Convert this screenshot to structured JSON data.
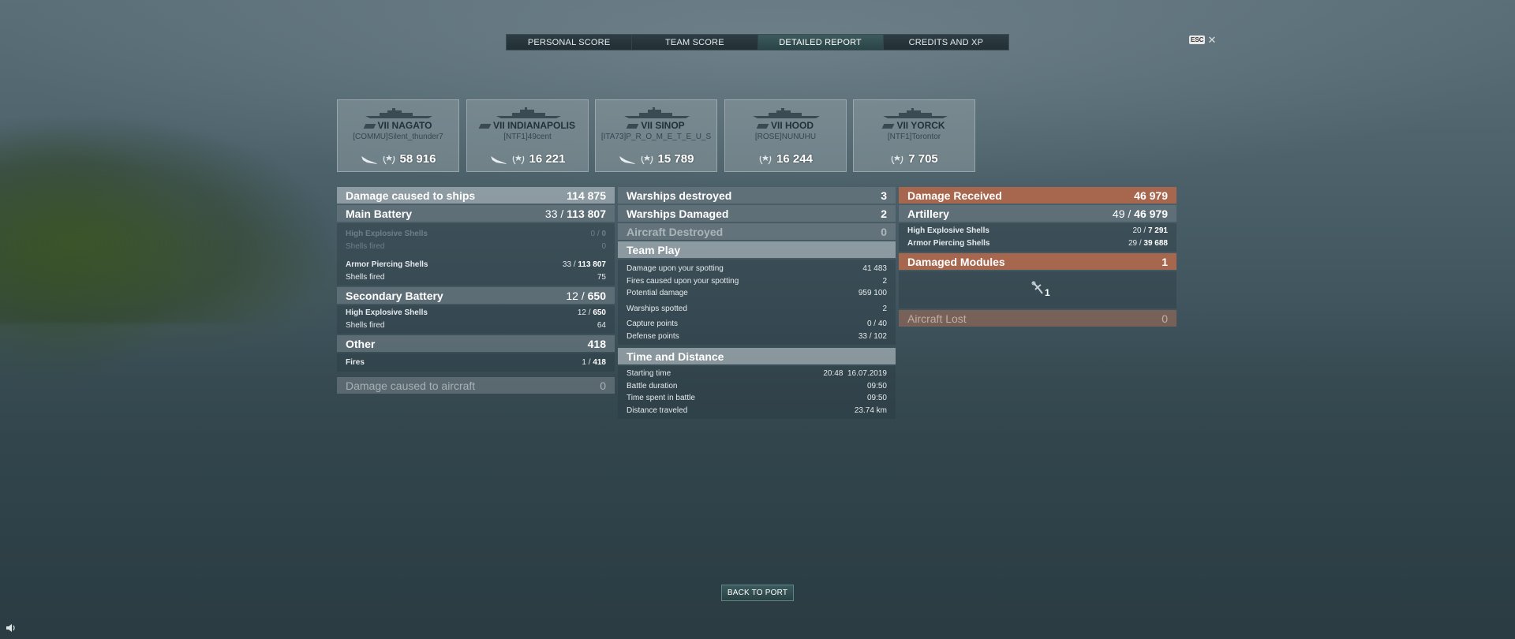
{
  "tabs": [
    {
      "label": "PERSONAL SCORE"
    },
    {
      "label": "TEAM SCORE"
    },
    {
      "label": "DETAILED REPORT"
    },
    {
      "label": "CREDITS AND XP"
    }
  ],
  "esc": {
    "key": "ESC",
    "close": "✕"
  },
  "ships": [
    {
      "name": "VII NAGATO",
      "player": "[COMMU]Silent_thunder7",
      "score": "58 916"
    },
    {
      "name": "VII INDIANAPOLIS",
      "player": "[NTF1]49cent",
      "score": "16 221"
    },
    {
      "name": "VII SINOP",
      "player": "[ITA73]P_R_O_M_E_T_E_U_S",
      "score": "15 789"
    },
    {
      "name": "VII HOOD",
      "player": "[ROSE]NUNUHU",
      "score": "16 244"
    },
    {
      "name": "VII YORCK",
      "player": "[NTF1]Torontor",
      "score": "7 705"
    }
  ],
  "damage": {
    "title": "Damage caused to ships",
    "total": "114 875",
    "main_battery": {
      "label": "Main Battery",
      "hits": "33",
      "value": "113 807"
    },
    "mb_he": {
      "label": "High Explosive Shells",
      "hits": "0",
      "value": "0"
    },
    "mb_he_fired": {
      "label": "Shells fired",
      "value": "0"
    },
    "mb_ap": {
      "label": "Armor Piercing Shells",
      "hits": "33",
      "value": "113 807"
    },
    "mb_ap_fired": {
      "label": "Shells fired",
      "value": "75"
    },
    "secondary": {
      "label": "Secondary Battery",
      "hits": "12",
      "value": "650"
    },
    "sec_he": {
      "label": "High Explosive Shells",
      "hits": "12",
      "value": "650"
    },
    "sec_fired": {
      "label": "Shells fired",
      "value": "64"
    },
    "other": {
      "label": "Other",
      "value": "418"
    },
    "fires": {
      "label": "Fires",
      "hits": "1",
      "value": "418"
    },
    "aircraft": {
      "label": "Damage caused to aircraft",
      "value": "0"
    }
  },
  "middle": {
    "destroyed": {
      "label": "Warships destroyed",
      "value": "3"
    },
    "damaged": {
      "label": "Warships Damaged",
      "value": "2"
    },
    "aircraft": {
      "label": "Aircraft Destroyed",
      "value": "0"
    },
    "team_play": {
      "title": "Team Play",
      "spotting_damage": {
        "label": "Damage upon your spotting",
        "value": "41 483"
      },
      "spotting_fires": {
        "label": "Fires caused upon your spotting",
        "value": "2"
      },
      "potential": {
        "label": "Potential damage",
        "value": "959 100"
      },
      "spotted": {
        "label": "Warships spotted",
        "value": "2"
      },
      "capture": {
        "label": "Capture points",
        "value": "0 / 40"
      },
      "defense": {
        "label": "Defense points",
        "value": "33 / 102"
      }
    },
    "time": {
      "title": "Time and Distance",
      "start": {
        "label": "Starting time",
        "value": "20:48  16.07.2019"
      },
      "duration": {
        "label": "Battle duration",
        "value": "09:50"
      },
      "spent": {
        "label": "Time spent in battle",
        "value": "09:50"
      },
      "distance": {
        "label": "Distance traveled",
        "value": "23.74 km"
      }
    }
  },
  "received": {
    "title": "Damage Received",
    "total": "46 979",
    "artillery": {
      "label": "Artillery",
      "hits": "49",
      "value": "46 979"
    },
    "he": {
      "label": "High Explosive Shells",
      "hits": "20",
      "value": "7 291"
    },
    "ap": {
      "label": "Armor Piercing Shells",
      "hits": "29",
      "value": "39 688"
    },
    "modules": {
      "label": "Damaged Modules",
      "value": "1",
      "icon_count": "1"
    },
    "aircraft_lost": {
      "label": "Aircraft Lost",
      "value": "0"
    }
  },
  "back_button": "BACK TO PORT",
  "colors": {
    "accent_orange": "#b4694b",
    "active_tab": "#3c5a5c"
  }
}
